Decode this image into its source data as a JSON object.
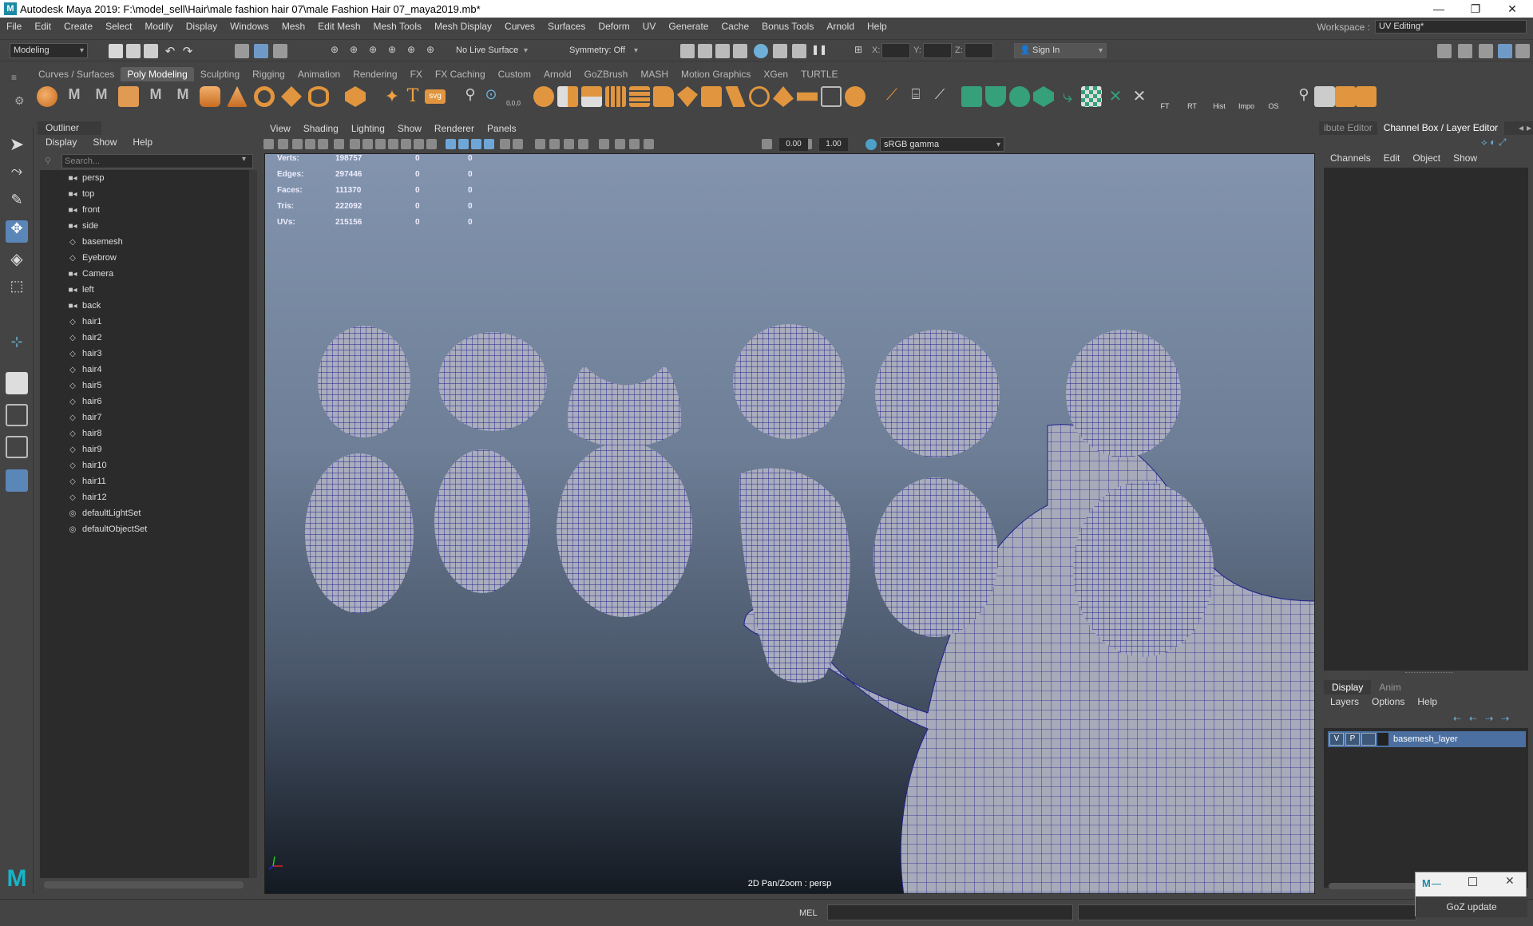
{
  "window": {
    "title": "Autodesk Maya 2019: F:\\model_sell\\Hair\\male fashion hair 07\\male Fashion Hair 07_maya2019.mb*",
    "logo": "M"
  },
  "menu": [
    "File",
    "Edit",
    "Create",
    "Select",
    "Modify",
    "Display",
    "Windows",
    "Mesh",
    "Edit Mesh",
    "Mesh Tools",
    "Mesh Display",
    "Curves",
    "Surfaces",
    "Deform",
    "UV",
    "Generate",
    "Cache",
    "Bonus Tools",
    "Arnold",
    "Help"
  ],
  "workspace": {
    "label": "Workspace :",
    "value": "UV Editing*"
  },
  "status": {
    "mode": "Modeling",
    "live_surface": "No Live Surface",
    "symmetry": "Symmetry: Off",
    "x_label": "X:",
    "y_label": "Y:",
    "z_label": "Z:",
    "sign_in": "Sign In"
  },
  "shelf_tabs": [
    "Curves / Surfaces",
    "Poly Modeling",
    "Sculpting",
    "Rigging",
    "Animation",
    "Rendering",
    "FX",
    "FX Caching",
    "Custom",
    "Arnold",
    "GoZBrush",
    "MASH",
    "Motion Graphics",
    "XGen",
    "TURTLE"
  ],
  "shelf_active": "Poly Modeling",
  "shelf_labels": {
    "ft": "FT",
    "rt": "RT",
    "hist": "Hist",
    "impo": "Impo",
    "os": "OS",
    "svg": "svg",
    "t": "T",
    "coords": "0,0,0"
  },
  "outliner": {
    "title": "Outliner",
    "menu": [
      "Display",
      "Show",
      "Help"
    ],
    "search_placeholder": "Search...",
    "items": [
      {
        "name": "persp",
        "icon": "camera-icon"
      },
      {
        "name": "top",
        "icon": "camera-icon"
      },
      {
        "name": "front",
        "icon": "camera-icon"
      },
      {
        "name": "side",
        "icon": "camera-icon"
      },
      {
        "name": "basemesh",
        "icon": "mesh-icon"
      },
      {
        "name": "Eyebrow",
        "icon": "mesh-icon"
      },
      {
        "name": "Camera",
        "icon": "camera-icon"
      },
      {
        "name": "left",
        "icon": "camera-icon"
      },
      {
        "name": "back",
        "icon": "camera-icon"
      },
      {
        "name": "hair1",
        "icon": "mesh-icon"
      },
      {
        "name": "hair2",
        "icon": "mesh-icon"
      },
      {
        "name": "hair3",
        "icon": "mesh-icon"
      },
      {
        "name": "hair4",
        "icon": "mesh-icon"
      },
      {
        "name": "hair5",
        "icon": "mesh-icon"
      },
      {
        "name": "hair6",
        "icon": "mesh-icon"
      },
      {
        "name": "hair7",
        "icon": "mesh-icon"
      },
      {
        "name": "hair8",
        "icon": "mesh-icon"
      },
      {
        "name": "hair9",
        "icon": "mesh-icon"
      },
      {
        "name": "hair10",
        "icon": "mesh-icon"
      },
      {
        "name": "hair11",
        "icon": "mesh-icon"
      },
      {
        "name": "hair12",
        "icon": "mesh-icon"
      },
      {
        "name": "defaultLightSet",
        "icon": "set-icon"
      },
      {
        "name": "defaultObjectSet",
        "icon": "set-icon"
      }
    ]
  },
  "viewport": {
    "menu": [
      "View",
      "Shading",
      "Lighting",
      "Show",
      "Renderer",
      "Panels"
    ],
    "field_a": "0.00",
    "field_b": "1.00",
    "color_space": "sRGB gamma",
    "hud": [
      {
        "label": "Verts:",
        "v1": "198757",
        "v2": "0",
        "v3": "0"
      },
      {
        "label": "Edges:",
        "v1": "297446",
        "v2": "0",
        "v3": "0"
      },
      {
        "label": "Faces:",
        "v1": "111370",
        "v2": "0",
        "v3": "0"
      },
      {
        "label": "Tris:",
        "v1": "222092",
        "v2": "0",
        "v3": "0"
      },
      {
        "label": "UVs:",
        "v1": "215156",
        "v2": "0",
        "v3": "0"
      }
    ],
    "camera_label": "2D Pan/Zoom : persp",
    "mesh_color": "#1e1e8c",
    "fill_color": "#a9adbd"
  },
  "channel_box": {
    "tabs": [
      "ibute Editor",
      "Channel Box / Layer Editor"
    ],
    "menu": [
      "Channels",
      "Edit",
      "Object",
      "Show"
    ]
  },
  "layers": {
    "tabs": [
      "Display",
      "Anim"
    ],
    "menu": [
      "Layers",
      "Options",
      "Help"
    ],
    "row": {
      "v": "V",
      "p": "P",
      "name": "basemesh_layer"
    }
  },
  "bottom": {
    "mel": "MEL"
  },
  "goz": {
    "label": "GoZ update"
  }
}
